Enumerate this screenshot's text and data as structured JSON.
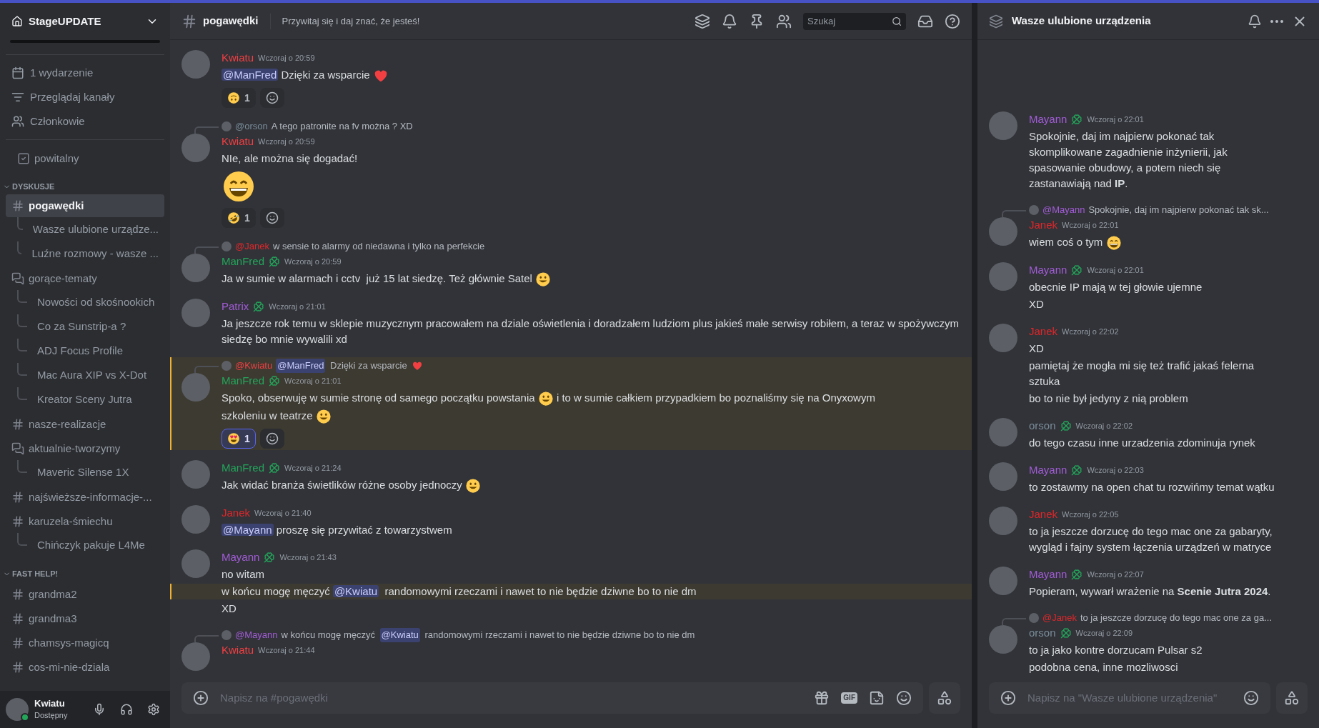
{
  "server": {
    "name": "StageUPDATE"
  },
  "sidebar": {
    "nav": [
      {
        "kind": "calendar",
        "label": "1 wydarzenie"
      },
      {
        "kind": "browse",
        "label": "Przeglądaj kanały"
      },
      {
        "kind": "members",
        "label": "Członkowie"
      }
    ],
    "groups": [
      {
        "items": [
          {
            "kind": "rules",
            "label": "powitalny",
            "selected": false
          }
        ]
      },
      {
        "category": "DYSKUSJE",
        "expanded": true,
        "items": [
          {
            "kind": "text",
            "label": "pogawędki",
            "selected": true,
            "children": [
              {
                "label": "Wasze ulubione urządze...",
                "selected": false
              },
              {
                "label": "Luźne rozmowy - wasze ...",
                "selected": false
              }
            ]
          },
          {
            "kind": "forum",
            "label": "gorące-tematy",
            "selected": false,
            "children": [
              {
                "label": "Nowości od skośnookich",
                "selected": false
              },
              {
                "label": "Co za Sunstrip-a ?",
                "selected": false
              },
              {
                "label": "ADJ Focus Profile",
                "selected": false
              },
              {
                "label": "Mac Aura XIP vs X-Dot",
                "selected": false
              },
              {
                "label": "Kreator Sceny Jutra",
                "selected": false
              }
            ]
          },
          {
            "kind": "text",
            "label": "nasze-realizacje",
            "selected": false
          },
          {
            "kind": "forum",
            "label": "aktualnie-tworzymy",
            "selected": false,
            "children": [
              {
                "label": "Maveric Silense 1X",
                "selected": false
              }
            ]
          },
          {
            "kind": "text",
            "label": "najświeższe-informacje-...",
            "selected": false
          },
          {
            "kind": "text",
            "label": "karuzela-śmiechu",
            "selected": false,
            "children": [
              {
                "label": "Chińczyk pakuje L4Me",
                "selected": false
              }
            ]
          }
        ]
      },
      {
        "category": "FAST HELP!",
        "expanded": true,
        "items": [
          {
            "kind": "text",
            "label": "grandma2",
            "selected": false
          },
          {
            "kind": "text",
            "label": "grandma3",
            "selected": false
          },
          {
            "kind": "text",
            "label": "chamsys-magicq",
            "selected": false
          },
          {
            "kind": "text",
            "label": "cos-mi-nie-dziala",
            "selected": false
          }
        ]
      }
    ]
  },
  "user": {
    "name": "Kwiatu",
    "status": "Dostępny"
  },
  "main": {
    "channel": "pogawędki",
    "topic": "Przywitaj się i daj znać, że jesteś!",
    "search": {
      "placeholder": "Szukaj"
    },
    "messages": [
      {
        "author": "Kwiatu",
        "color": "#f23f42",
        "badge": false,
        "time": "Wczoraj o 20:59",
        "highlighted": false,
        "lines": [
          {
            "highlighted": false,
            "parts": [
              {
                "kind": "mention",
                "text": "@ManFred"
              },
              " Dzięki za wsparcie ",
              {
                "kind": "heart"
              }
            ]
          }
        ],
        "reactions": [
          {
            "kind": "upside",
            "count": "1",
            "selected": false
          }
        ]
      },
      {
        "reply": {
          "author": "@orson",
          "color": "#7a8c99",
          "parts": [
            "A tego patronite na fv można ? XD"
          ]
        },
        "author": "Kwiatu",
        "color": "#f23f42",
        "badge": false,
        "time": "Wczoraj o 20:59",
        "highlighted": false,
        "lines": [
          {
            "highlighted": false,
            "parts": [
              "NIe, ale można się dogadać!"
            ]
          }
        ],
        "reactions": [
          {
            "kind": "rofl",
            "count": "1",
            "selected": false
          }
        ],
        "after": [
          {
            "highlighted": false,
            "parts": [
              {
                "kind": "grin",
                "jumbo": true
              }
            ]
          }
        ]
      },
      {
        "reply": {
          "author": "@Janek",
          "color": "#e0272a",
          "parts": [
            "w sensie to alarmy od niedawna i tylko na perfekcie"
          ]
        },
        "author": "ManFred",
        "color": "#23a55a",
        "badge": true,
        "time": "Wczoraj o 20:59",
        "highlighted": false,
        "lines": [
          {
            "highlighted": false,
            "parts": [
              "Ja w sumie w alarmach i cctv  już 15 lat siedzę. Też głównie Satel ",
              {
                "kind": "smiley"
              }
            ]
          }
        ]
      },
      {
        "author": "Patrix",
        "color": "#a25cd6",
        "badge": true,
        "time": "Wczoraj o 21:01",
        "highlighted": false,
        "lines": [
          {
            "highlighted": false,
            "parts": [
              "Ja jeszcze rok temu w sklepie muzycznym pracowałem na dziale oświetlenia i doradzałem ludziom plus jakieś małe serwisy robiłem, a teraz w spożywczym siedzę bo mnie wywalili xd"
            ]
          }
        ]
      },
      {
        "reply": {
          "author": "@Kwiatu",
          "color": "#f23f42",
          "parts": [
            {
              "kind": "mention",
              "text": "@ManFred"
            },
            " Dzięki za wsparcie ",
            {
              "kind": "heart"
            }
          ]
        },
        "author": "ManFred",
        "color": "#23a55a",
        "badge": true,
        "time": "Wczoraj o 21:01",
        "highlighted": true,
        "lines": [
          {
            "highlighted": false,
            "parts": [
              "Spoko, obserwuję w sumie stronę od samego początku powstania ",
              {
                "kind": "smiley"
              },
              " i to w sumie całkiem przypadkiem bo poznaliśmy się na Onyxowym"
            ]
          },
          {
            "highlighted": false,
            "parts": [
              "szkoleniu w teatrze ",
              {
                "kind": "smiley"
              }
            ]
          }
        ],
        "reactions": [
          {
            "kind": "hearteyes",
            "count": "1",
            "selected": true
          }
        ]
      },
      {
        "author": "ManFred",
        "color": "#23a55a",
        "badge": true,
        "time": "Wczoraj o 21:24",
        "highlighted": false,
        "lines": [
          {
            "highlighted": false,
            "parts": [
              "Jak widać branża świetlików różne osoby jednoczy ",
              {
                "kind": "smiley"
              }
            ]
          }
        ]
      },
      {
        "author": "Janek",
        "color": "#e0272a",
        "badge": false,
        "time": "Wczoraj o 21:40",
        "highlighted": false,
        "lines": [
          {
            "highlighted": false,
            "parts": [
              {
                "kind": "mention",
                "text": "@Mayann"
              },
              " proszę się przywitać z towarzystwem"
            ]
          }
        ]
      },
      {
        "author": "Mayann",
        "color": "#a25cd6",
        "badge": true,
        "time": "Wczoraj o 21:43",
        "highlighted": false,
        "lines": [
          {
            "highlighted": false,
            "parts": [
              "no witam"
            ]
          },
          {
            "highlighted": true,
            "parts": [
              "w końcu mogę męczyć ",
              {
                "kind": "mention",
                "text": "@Kwiatu"
              },
              "  randomowymi rzeczami i nawet to nie będzie dziwne bo to nie dm"
            ]
          },
          {
            "highlighted": false,
            "parts": [
              "XD"
            ]
          }
        ]
      },
      {
        "reply": {
          "author": "@Mayann",
          "color": "#a25cd6",
          "parts": [
            "w końcu mogę męczyć ",
            {
              "kind": "mention",
              "text": "@Kwiatu"
            },
            " randomowymi rzeczami i nawet to nie będzie dziwne bo to nie dm"
          ]
        },
        "author": "Kwiatu",
        "color": "#f23f42",
        "badge": false,
        "time": "Wczoraj o 21:44",
        "highlighted": false
      }
    ],
    "composer": {
      "placeholder": "Napisz na #pogawędki",
      "gif": "GIF"
    }
  },
  "thread": {
    "title": "Wasze ulubione urządzenia",
    "messages": [
      {
        "author": "Mayann",
        "color": "#a25cd6",
        "badge": true,
        "time": "Wczoraj o 22:01",
        "highlighted": false,
        "lines": [
          {
            "highlighted": false,
            "parts": [
              "Spokojnie, daj im najpierw pokonać tak skomplikowane zagadnienie inżynierii, jak spasowanie obudowy, a potem niech się zastanawiają nad **IP**."
            ]
          }
        ]
      },
      {
        "reply": {
          "author": "@Mayann",
          "color": "#a25cd6",
          "parts": [
            "Spokojnie, daj im najpierw pokonać tak sk..."
          ]
        },
        "author": "Janek",
        "color": "#e0272a",
        "badge": false,
        "time": "Wczoraj o 22:01",
        "highlighted": false,
        "lines": [
          {
            "highlighted": false,
            "parts": [
              "wiem coś o tym ",
              {
                "kind": "grin"
              }
            ]
          }
        ]
      },
      {
        "author": "Mayann",
        "color": "#a25cd6",
        "badge": true,
        "time": "Wczoraj o 22:01",
        "highlighted": false,
        "lines": [
          {
            "highlighted": false,
            "parts": [
              "obecnie IP mają w tej głowie ujemne"
            ]
          },
          {
            "highlighted": false,
            "parts": [
              "XD"
            ]
          }
        ]
      },
      {
        "author": "Janek",
        "color": "#e0272a",
        "badge": false,
        "time": "Wczoraj o 22:02",
        "highlighted": false,
        "lines": [
          {
            "highlighted": false,
            "parts": [
              "XD"
            ]
          },
          {
            "highlighted": false,
            "parts": [
              "pamiętaj że mogła mi się też trafić jakaś felerna sztuka"
            ]
          },
          {
            "highlighted": false,
            "parts": [
              "bo to nie był jedyny z nią problem"
            ]
          }
        ]
      },
      {
        "author": "orson",
        "color": "#7a8c99",
        "badge": true,
        "time": "Wczoraj o 22:02",
        "highlighted": false,
        "lines": [
          {
            "highlighted": false,
            "parts": [
              "do tego czasu inne urzadzenia zdominuja rynek"
            ]
          }
        ]
      },
      {
        "author": "Mayann",
        "color": "#a25cd6",
        "badge": true,
        "time": "Wczoraj o 22:03",
        "highlighted": false,
        "lines": [
          {
            "highlighted": false,
            "parts": [
              "to zostawmy na open chat tu rozwińmy temat wątku"
            ]
          }
        ]
      },
      {
        "author": "Janek",
        "color": "#e0272a",
        "badge": false,
        "time": "Wczoraj o 22:05",
        "highlighted": false,
        "lines": [
          {
            "highlighted": false,
            "parts": [
              "to ja jeszcze dorzucę do tego mac one za gabaryty, wygląd i fajny system łączenia urządzeń w matryce"
            ]
          }
        ]
      },
      {
        "author": "Mayann",
        "color": "#a25cd6",
        "badge": true,
        "time": "Wczoraj o 22:07",
        "highlighted": false,
        "lines": [
          {
            "highlighted": false,
            "parts": [
              "Popieram, wywarł wrażenie na **Scenie Jutra 2024**."
            ]
          }
        ]
      },
      {
        "reply": {
          "author": "@Janek",
          "color": "#e0272a",
          "parts": [
            "to ja jeszcze dorzucę do tego mac one za ga..."
          ]
        },
        "author": "orson",
        "color": "#7a8c99",
        "badge": true,
        "time": "Wczoraj o 22:09",
        "highlighted": false,
        "lines": [
          {
            "highlighted": false,
            "parts": [
              "to ja jako kontre dorzucam Pulsar s2"
            ]
          },
          {
            "highlighted": false,
            "parts": [
              "podobna cena, inne mozliwosci"
            ]
          }
        ]
      }
    ],
    "composer": {
      "placeholder": "Napisz na \"Wasze ulubione urządzenia\""
    }
  }
}
